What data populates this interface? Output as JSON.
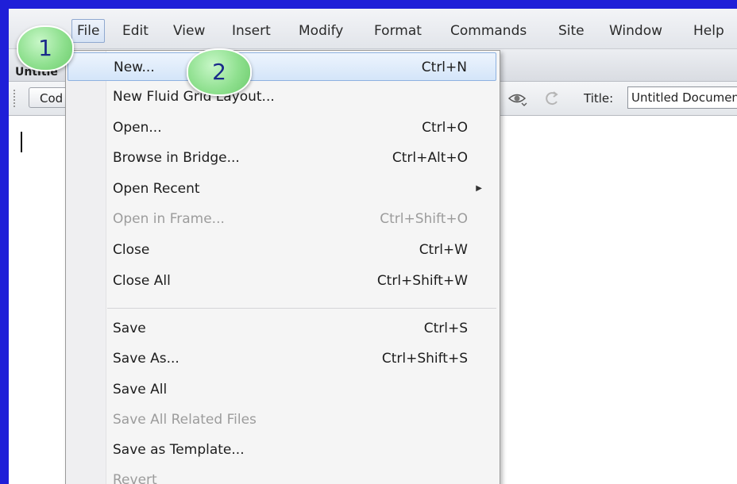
{
  "menubar": {
    "items": [
      "File",
      "Edit",
      "View",
      "Insert",
      "Modify",
      "Format",
      "Commands",
      "Site",
      "Window",
      "Help"
    ]
  },
  "doc_tab": {
    "label": "Untitle"
  },
  "toolbar": {
    "code_label": "Cod",
    "title_label": "Title:",
    "title_value": "Untitled Document"
  },
  "file_menu": {
    "items": [
      {
        "label": "New...",
        "shortcut": "Ctrl+N",
        "state": "highlighted"
      },
      {
        "label": "New Fluid Grid Layout...",
        "shortcut": "",
        "state": "enabled"
      },
      {
        "label": "Open...",
        "shortcut": "Ctrl+O",
        "state": "enabled"
      },
      {
        "label": "Browse in Bridge...",
        "shortcut": "Ctrl+Alt+O",
        "state": "enabled"
      },
      {
        "label": "Open Recent",
        "shortcut": "",
        "state": "enabled",
        "submenu": true
      },
      {
        "label": "Open in Frame...",
        "shortcut": "Ctrl+Shift+O",
        "state": "disabled"
      },
      {
        "label": "Close",
        "shortcut": "Ctrl+W",
        "state": "enabled"
      },
      {
        "label": "Close All",
        "shortcut": "Ctrl+Shift+W",
        "state": "enabled"
      },
      {
        "label": "Save",
        "shortcut": "Ctrl+S",
        "state": "enabled"
      },
      {
        "label": "Save As...",
        "shortcut": "Ctrl+Shift+S",
        "state": "enabled"
      },
      {
        "label": "Save All",
        "shortcut": "",
        "state": "enabled"
      },
      {
        "label": "Save All Related Files",
        "shortcut": "",
        "state": "disabled"
      },
      {
        "label": "Save as Template...",
        "shortcut": "",
        "state": "enabled"
      },
      {
        "label": "Revert",
        "shortcut": "",
        "state": "disabled"
      }
    ]
  },
  "callouts": {
    "step1": "1",
    "step2": "2"
  },
  "colors": {
    "frame": "#1f1fd8",
    "callout": "#8fe08f",
    "callout_text": "#1a2a8a",
    "highlight": "#d4e5f9"
  }
}
